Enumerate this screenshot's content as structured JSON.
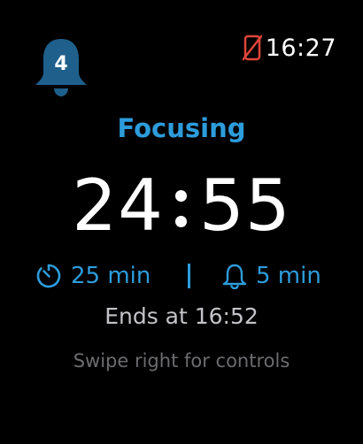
{
  "notifications": {
    "count": "4",
    "icon": "bell-icon",
    "color": "#1f5f8b"
  },
  "status": {
    "phone_icon": "phone-disconnected-icon",
    "phone_icon_color": "#e0453a",
    "time": "16:27"
  },
  "focus": {
    "title": "Focusing",
    "accent": "#2d9cdb",
    "timer_minutes": "24",
    "timer_seconds": "55"
  },
  "durations": {
    "work_icon": "timer-icon",
    "work_label": "25 min",
    "break_icon": "bell-icon",
    "break_label": "5 min"
  },
  "ends_text": "Ends at 16:52",
  "hint_text": "Swipe right for controls"
}
